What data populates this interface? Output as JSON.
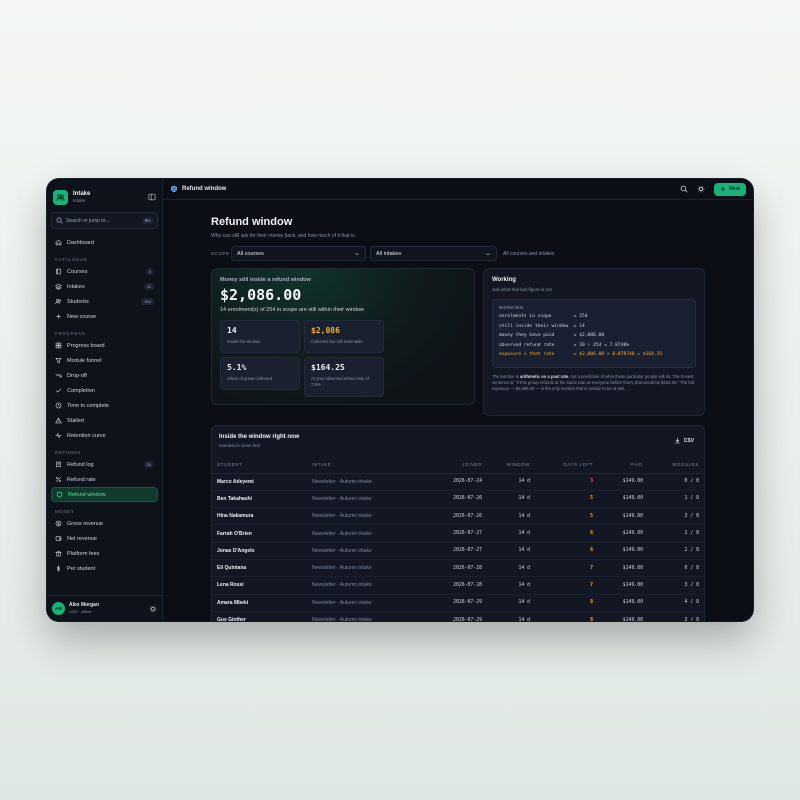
{
  "app": {
    "name": "Intake",
    "sub": "Intake"
  },
  "search": {
    "placeholder": "Search or jump to...",
    "shortcut": "⌘K"
  },
  "nav": {
    "top": [
      {
        "label": "Dashboard",
        "icon": "home-icon"
      }
    ],
    "sections": [
      {
        "title": "CATALOGUE",
        "items": [
          {
            "label": "Courses",
            "badge": "5",
            "icon": "book-icon"
          },
          {
            "label": "Intakes",
            "badge": "11",
            "icon": "layers-icon"
          },
          {
            "label": "Students",
            "badge": "254",
            "icon": "users-icon"
          },
          {
            "label": "New course",
            "badge": "",
            "icon": "plus-icon"
          }
        ]
      },
      {
        "title": "PROGRESS",
        "items": [
          {
            "label": "Progress board",
            "icon": "grid-icon"
          },
          {
            "label": "Module funnel",
            "icon": "funnel-icon"
          },
          {
            "label": "Drop-off",
            "icon": "trend-down-icon"
          },
          {
            "label": "Completion",
            "icon": "check-icon"
          },
          {
            "label": "Time to complete",
            "icon": "clock-icon"
          },
          {
            "label": "Stalled",
            "icon": "alert-icon"
          },
          {
            "label": "Retention curve",
            "icon": "pulse-icon"
          }
        ]
      },
      {
        "title": "REFUNDS",
        "items": [
          {
            "label": "Refund log",
            "badge": "20",
            "icon": "receipt-icon"
          },
          {
            "label": "Refund rate",
            "icon": "percent-icon"
          },
          {
            "label": "Refund window",
            "icon": "shield-icon",
            "active": true
          }
        ]
      },
      {
        "title": "MONEY",
        "items": [
          {
            "label": "Gross revenue",
            "icon": "coin-icon"
          },
          {
            "label": "Net revenue",
            "icon": "wallet-icon"
          },
          {
            "label": "Platform fees",
            "icon": "bank-icon"
          },
          {
            "label": "Per student",
            "icon": "dollar-icon"
          }
        ]
      }
    ]
  },
  "user": {
    "initials": "AM",
    "name": "Alex Morgan",
    "sub": "USD · offline"
  },
  "topbar": {
    "title": "Refund window",
    "new_label": "New"
  },
  "page": {
    "title": "Refund window",
    "subtitle": "Who can still ask for their money back, and how much of it that is",
    "scope_label": "SCOPE",
    "course_select": "All courses",
    "intake_select": "All intakes",
    "filter_note": "All courses and intakes"
  },
  "hero": {
    "label": "Money still inside a refund window",
    "value": "$2,086.00",
    "note": "14 enrolment(s) of 254 in scope are still within their window",
    "stats": [
      {
        "value": "14",
        "label": "Inside the window",
        "tone": "default"
      },
      {
        "value": "$2,086",
        "label": "Collected but still returnable",
        "tone": "amber"
      },
      {
        "value": "5.1%",
        "label": "Share of gross collected",
        "tone": "default"
      },
      {
        "value": "$164.25",
        "label": "At your observed refund rate of 7.9%",
        "tone": "default"
      }
    ]
  },
  "working": {
    "title": "Working",
    "subtitle": "and what that last figure is not",
    "code_head": "WORKING",
    "lines": [
      "enrolments in scope        = 254",
      "still inside their window  = 14",
      "money they have paid       = $2,086.00",
      "observed refund rate       = 20 ÷ 254 = 7.8740%",
      "exposure × that rate       = $2,086.00 × 0.078740 = $164.25"
    ],
    "foot_pre": "The last line is ",
    "foot_bold": "arithmetic on a past rate",
    "foot_post": ", not a prediction of what these particular people will do. The honest sentence is: \"if this group refunds at the same rate as everyone before them, that would be $164.25.\" The full exposure — $2,086.00 — is the only number that is certain to be at risk."
  },
  "table": {
    "title": "Inside the window right now",
    "subtitle": "soonest to close first",
    "csv_label": "CSV",
    "columns": [
      "STUDENT",
      "INTAKE",
      "JOINED",
      "WINDOW",
      "DAYS LEFT",
      "PAID",
      "MODULES"
    ],
    "rows": [
      {
        "student": "Marco Adeyemi",
        "intake": "Newsletter · Autumn intake",
        "joined": "2026-07-24",
        "window": "14 d",
        "days_left": "3",
        "paid": "$149.00",
        "modules": "0 / 8"
      },
      {
        "student": "Ben Takahashi",
        "intake": "Newsletter · Autumn intake",
        "joined": "2026-07-26",
        "window": "14 d",
        "days_left": "5",
        "paid": "$149.00",
        "modules": "1 / 8"
      },
      {
        "student": "Hina Nakamura",
        "intake": "Newsletter · Autumn intake",
        "joined": "2026-07-26",
        "window": "14 d",
        "days_left": "5",
        "paid": "$149.00",
        "modules": "3 / 8"
      },
      {
        "student": "Farrah O'Brien",
        "intake": "Newsletter · Autumn intake",
        "joined": "2026-07-27",
        "window": "14 d",
        "days_left": "6",
        "paid": "$149.00",
        "modules": "1 / 8"
      },
      {
        "student": "Jonas D'Angelo",
        "intake": "Newsletter · Autumn intake",
        "joined": "2026-07-27",
        "window": "14 d",
        "days_left": "6",
        "paid": "$149.00",
        "modules": "2 / 8"
      },
      {
        "student": "Eli Quintana",
        "intake": "Newsletter · Autumn intake",
        "joined": "2026-07-28",
        "window": "14 d",
        "days_left": "7",
        "paid": "$149.00",
        "modules": "0 / 8"
      },
      {
        "student": "Lena Rossi",
        "intake": "Newsletter · Autumn intake",
        "joined": "2026-07-28",
        "window": "14 d",
        "days_left": "7",
        "paid": "$149.00",
        "modules": "3 / 8"
      },
      {
        "student": "Amara Mbeki",
        "intake": "Newsletter · Autumn intake",
        "joined": "2026-07-29",
        "window": "14 d",
        "days_left": "8",
        "paid": "$149.00",
        "modules": "4 / 8"
      },
      {
        "student": "Gus Ginther",
        "intake": "Newsletter · Autumn intake",
        "joined": "2026-07-29",
        "window": "14 d",
        "days_left": "8",
        "paid": "$149.00",
        "modules": "3 / 8"
      }
    ]
  },
  "colors": {
    "accent": "#19b37a",
    "amber": "#f2b233",
    "red": "#ef5a5a",
    "bg": "#0b0e14"
  }
}
